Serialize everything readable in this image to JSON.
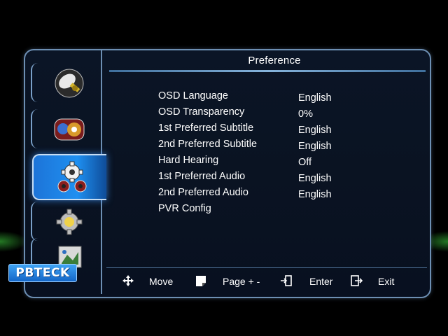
{
  "panel": {
    "title": "Preference"
  },
  "sidebar": {
    "items": [
      {
        "icon": "satellite-dish-icon"
      },
      {
        "icon": "media-player-icon"
      },
      {
        "icon": "gears-settings-icon",
        "active": true
      },
      {
        "icon": "system-gear-icon"
      },
      {
        "icon": "media-files-icon"
      }
    ]
  },
  "menu": {
    "items": [
      {
        "label": "OSD Language",
        "value": "English"
      },
      {
        "label": "OSD Transparency",
        "value": "0%"
      },
      {
        "label": "1st Preferred Subtitle",
        "value": "English"
      },
      {
        "label": "2nd Preferred Subtitle",
        "value": "English"
      },
      {
        "label": "Hard Hearing",
        "value": "Off"
      },
      {
        "label": "1st Preferred Audio",
        "value": "English"
      },
      {
        "label": "2nd Preferred Audio",
        "value": "English"
      },
      {
        "label": "PVR Config",
        "value": ""
      }
    ]
  },
  "footer": {
    "move": "Move",
    "page": "Page + -",
    "enter": "Enter",
    "exit": "Exit"
  },
  "watermark": {
    "text": "PBTECK"
  },
  "colors": {
    "accent": "#1e8ff0",
    "frame": "#6d8fb3",
    "background": "#0a1322"
  }
}
